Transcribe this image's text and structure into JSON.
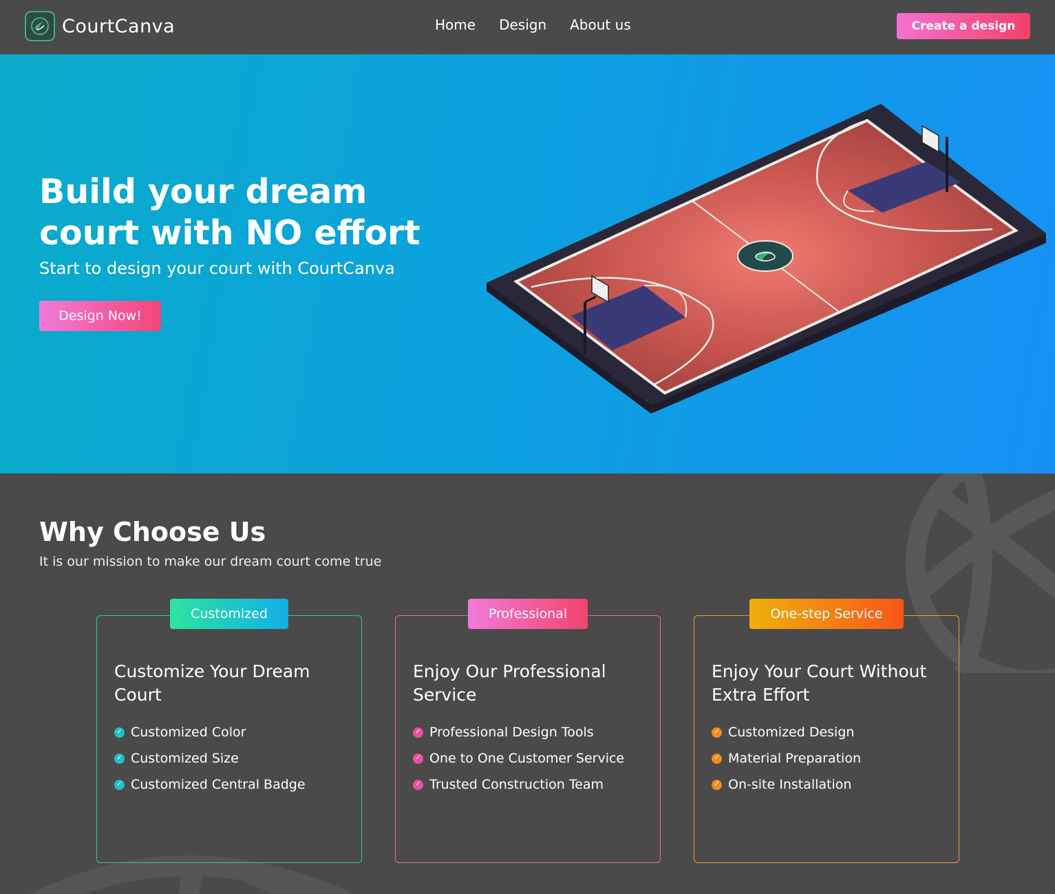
{
  "nav": {
    "brand": "CourtCanva",
    "links": [
      "Home",
      "Design",
      "About us"
    ],
    "cta_label": "Create a design"
  },
  "hero": {
    "title": "Build your dream court with NO effort",
    "subtitle": "Start to design your court with CourtCanva",
    "button_label": "Design Now!"
  },
  "why": {
    "title": "Why Choose Us",
    "subtitle": "It is our mission to make our dream court come true",
    "cards": [
      {
        "badge": "Customized",
        "title": "Customize Your Dream Court",
        "features": [
          "Customized Color",
          "Customized Size",
          "Customized Central Badge"
        ],
        "accent": "#2bc8a8"
      },
      {
        "badge": "Professional",
        "title": "Enjoy Our Professional Service",
        "features": [
          "Professional Design Tools",
          "One to One Customer Service",
          "Trusted Construction Team"
        ],
        "accent": "#e46aa8"
      },
      {
        "badge": "One-step Service",
        "title": "Enjoy Your Court Without Extra Effort",
        "features": [
          "Customized Design",
          "Material Preparation",
          "On-site Installation"
        ],
        "accent": "#f09a2a"
      }
    ]
  },
  "colors": {
    "page_bg": "#4a4a4a",
    "hero_gradient_start": "#0aabc9",
    "hero_gradient_end": "#1790f5",
    "cta_gradient_start": "#f472d0",
    "cta_gradient_end": "#f43f6a",
    "court_surface": "#c7564f",
    "court_key": "#3a3a78"
  },
  "icons": {
    "logo": "basketball-logo-icon",
    "check": "check-circle-icon",
    "court": "isometric-basketball-court-illustration",
    "watermark": "basketball-watermark-icon"
  }
}
